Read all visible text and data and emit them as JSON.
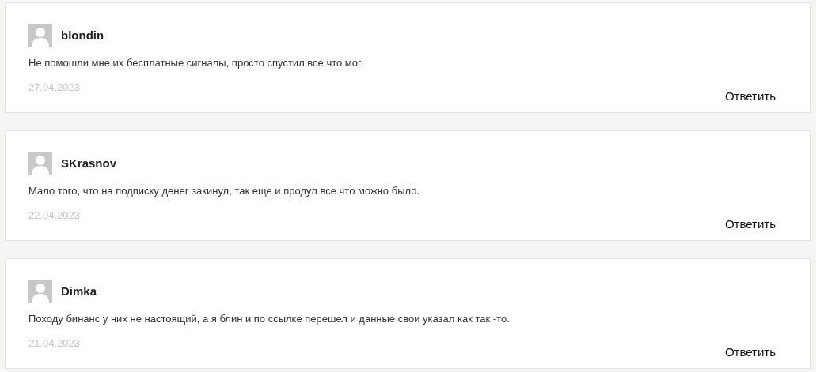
{
  "comments": [
    {
      "author": "blondin",
      "text": "Не помошли мне их бесплатные сигналы, просто спустил все что мог.",
      "date": "27.04.2023",
      "reply": "Ответить"
    },
    {
      "author": "SKrasnov",
      "text": "Мало того, что на подписку денег закинул, так еще и продул все что можно было.",
      "date": "22.04.2023",
      "reply": "Ответить"
    },
    {
      "author": "Dimka",
      "text": "Походу бинанс у них не настоящий, а я блин и по ссылке перешел и данные свои указал как так -то.",
      "date": "21.04.2023",
      "reply": "Ответить"
    }
  ]
}
